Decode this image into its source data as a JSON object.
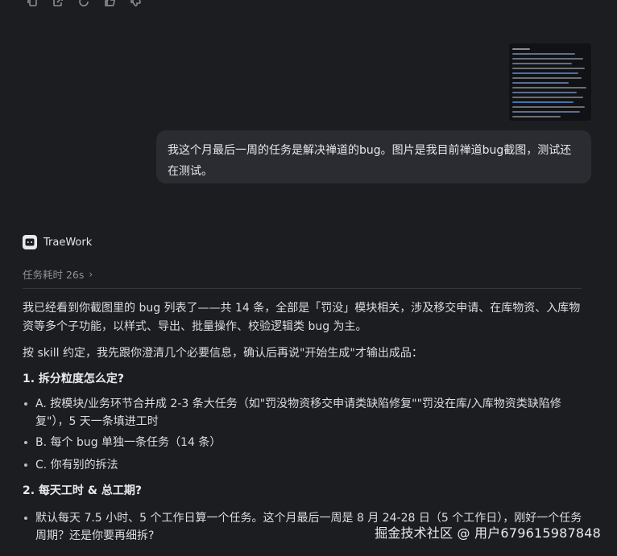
{
  "user_message": {
    "text": "我这个月最后一周的任务是解决禅道的bug。图片是我目前禅道bug截图，测试还在测试。"
  },
  "assistant": {
    "name": "TraeWork",
    "task_time": "任务耗时 26s",
    "intro": "我已经看到你截图里的 bug 列表了——共 14 条，全部是「罚没」模块相关，涉及移交申请、在库物资、入库物资等多个子功能，以样式、导出、批量操作、校验逻辑类 bug 为主。",
    "skill_note": "按 skill 约定，我先跟你澄清几个必要信息，确认后再说\"开始生成\"才输出成品：",
    "q1_title": "1. 拆分粒度怎么定?",
    "q1_options": [
      "A. 按模块/业务环节合并成 2-3 条大任务（如\"罚没物资移交申请类缺陷修复\"\"罚没在库/入库物资类缺陷修复\"），5 天一条填进工时",
      "B. 每个 bug 单独一条任务（14 条）",
      "C. 你有别的拆法"
    ],
    "q2_title": "2. 每天工时 & 总工期?",
    "q2_options": [
      "默认每天 7.5 小时、5 个工作日算一个任务。这个月最后一周是 8 月 24-28 日（5 个工作日），刚好一个任务周期？还是你要再细拆?"
    ]
  },
  "watermark": "掘金技术社区 @ 用户679615987848",
  "icons": [
    "copy-icon",
    "share-icon",
    "regenerate-icon",
    "thumbs-up-icon",
    "thumbs-down-icon"
  ],
  "colors": {
    "background": "#1c1d21",
    "bubble": "#2b2c31",
    "text": "#dcdde0",
    "muted": "#8e9096"
  }
}
